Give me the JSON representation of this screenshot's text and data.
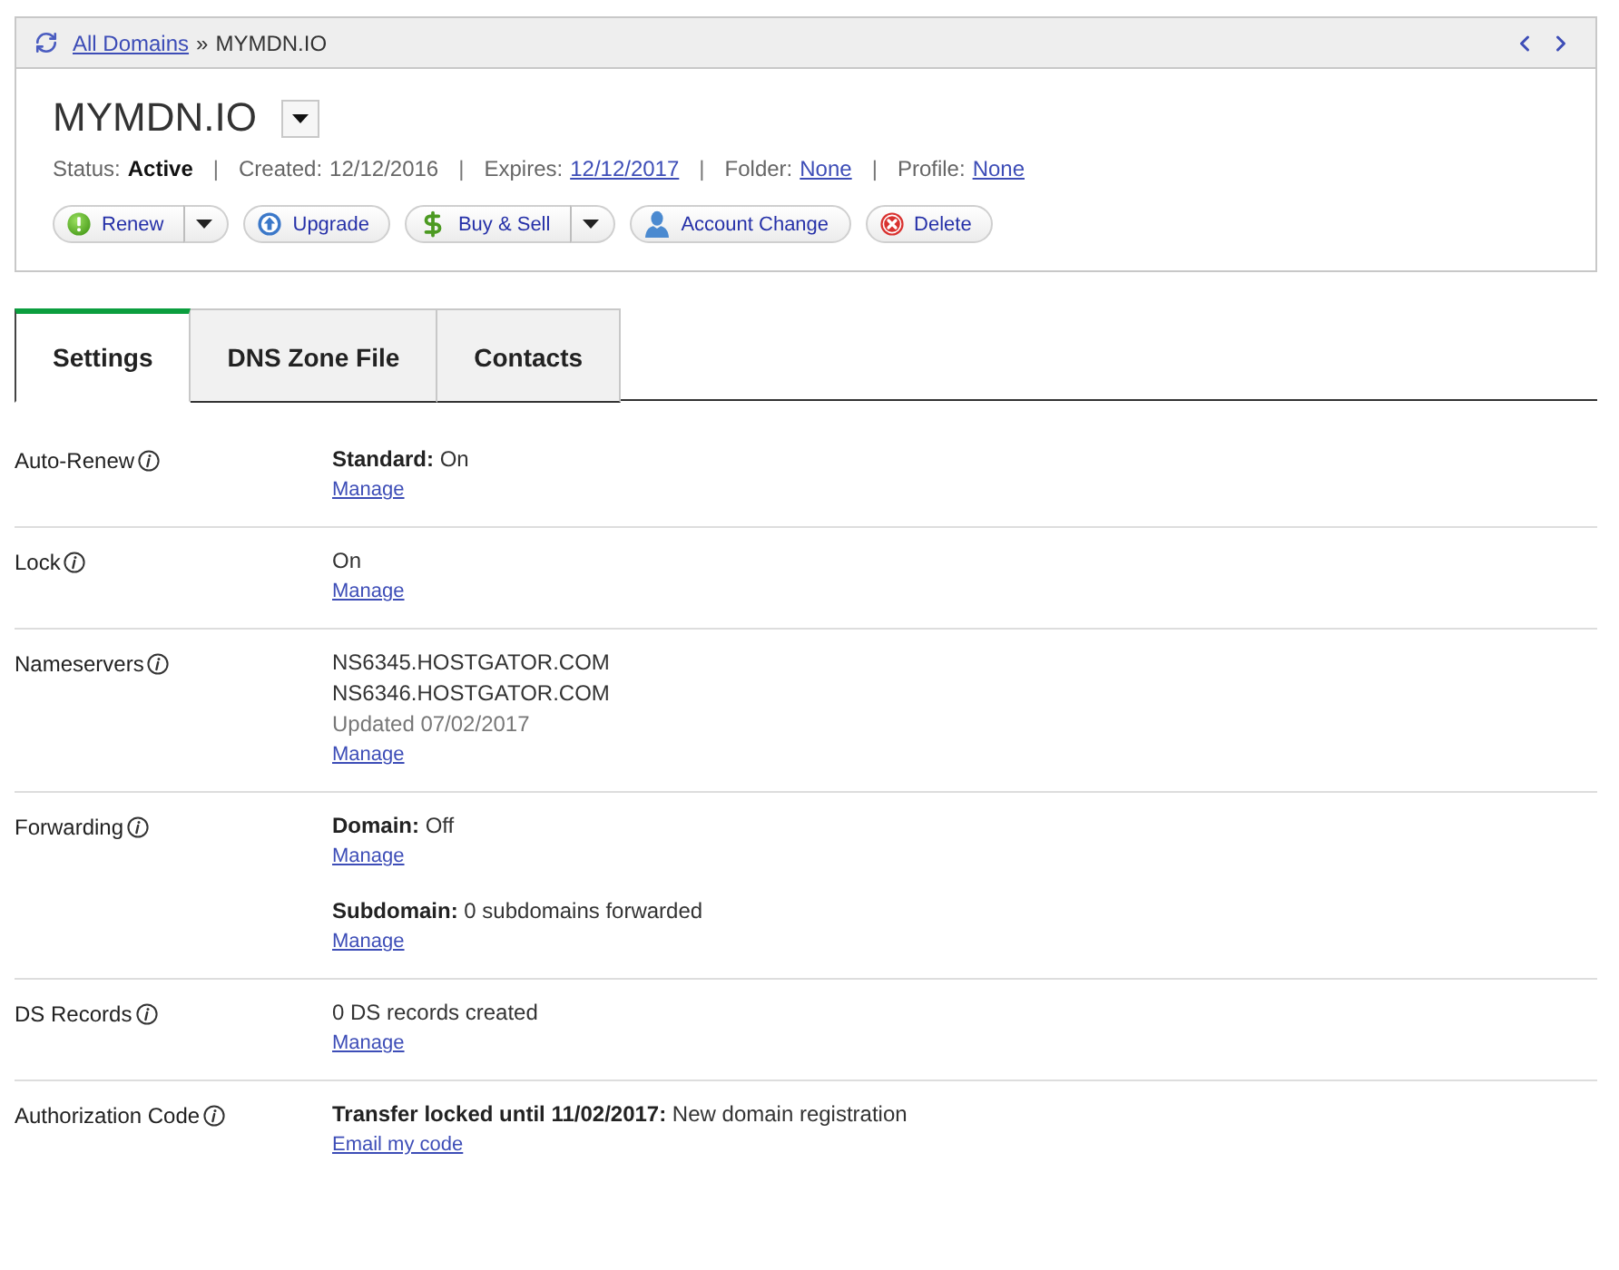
{
  "breadcrumb": {
    "items": [
      {
        "label": "All Domains",
        "current": false
      },
      {
        "label": "MYMDN.IO",
        "current": true
      }
    ],
    "separator": "»"
  },
  "domain": {
    "name": "MYMDN.IO"
  },
  "status_line": [
    {
      "label": "Status:",
      "value": "Active",
      "kind": "bold"
    },
    {
      "separator": "|",
      "label": "Created:",
      "value": "12/12/2016",
      "kind": "plain"
    },
    {
      "separator": "|",
      "label": "Expires:",
      "value": "12/12/2017",
      "kind": "link"
    },
    {
      "separator": "|",
      "label": "Folder:",
      "value": "None",
      "kind": "link"
    },
    {
      "separator": "|",
      "label": "Profile:",
      "value": "None",
      "kind": "link"
    }
  ],
  "actions": [
    {
      "label": "Renew",
      "kind": "renew",
      "menu": true
    },
    {
      "label": "Upgrade",
      "kind": "upgrade",
      "menu": false
    },
    {
      "label": "Buy & Sell",
      "kind": "trade",
      "menu": true
    },
    {
      "label": "Account Change",
      "kind": "account",
      "menu": false
    },
    {
      "label": "Delete",
      "kind": "delete",
      "menu": false
    }
  ],
  "tabs": [
    {
      "label": "Settings",
      "selected": true
    },
    {
      "label": "DNS Zone File",
      "selected": false
    },
    {
      "label": "Contacts",
      "selected": false
    }
  ],
  "settings": [
    {
      "label": "Auto-Renew",
      "groups": [
        {
          "lines": [
            {
              "text": "**Standard:** On",
              "muted": false
            }
          ],
          "link": "Manage"
        }
      ]
    },
    {
      "label": "Lock",
      "groups": [
        {
          "lines": [
            {
              "text": "On",
              "muted": false
            }
          ],
          "link": "Manage"
        }
      ]
    },
    {
      "label": "Nameservers",
      "groups": [
        {
          "lines": [
            {
              "text": "NS6345.HOSTGATOR.COM",
              "muted": false
            },
            {
              "text": "NS6346.HOSTGATOR.COM",
              "muted": false
            },
            {
              "text": "Updated 07/02/2017",
              "muted": true
            }
          ],
          "link": "Manage"
        }
      ]
    },
    {
      "label": "Forwarding",
      "groups": [
        {
          "lines": [
            {
              "text": "**Domain:** Off",
              "muted": false
            }
          ],
          "link": "Manage"
        },
        {
          "lines": [
            {
              "text": "**Subdomain:** 0 subdomains forwarded",
              "muted": false
            }
          ],
          "link": "Manage"
        }
      ]
    },
    {
      "label": "DS Records",
      "groups": [
        {
          "lines": [
            {
              "text": "0 DS records created",
              "muted": false
            }
          ],
          "link": "Manage"
        }
      ]
    },
    {
      "label": "Authorization Code",
      "groups": [
        {
          "lines": [
            {
              "text": "**Transfer locked until 11/02/2017:** New domain registration",
              "muted": false
            }
          ],
          "link": "Email my code"
        }
      ]
    }
  ]
}
